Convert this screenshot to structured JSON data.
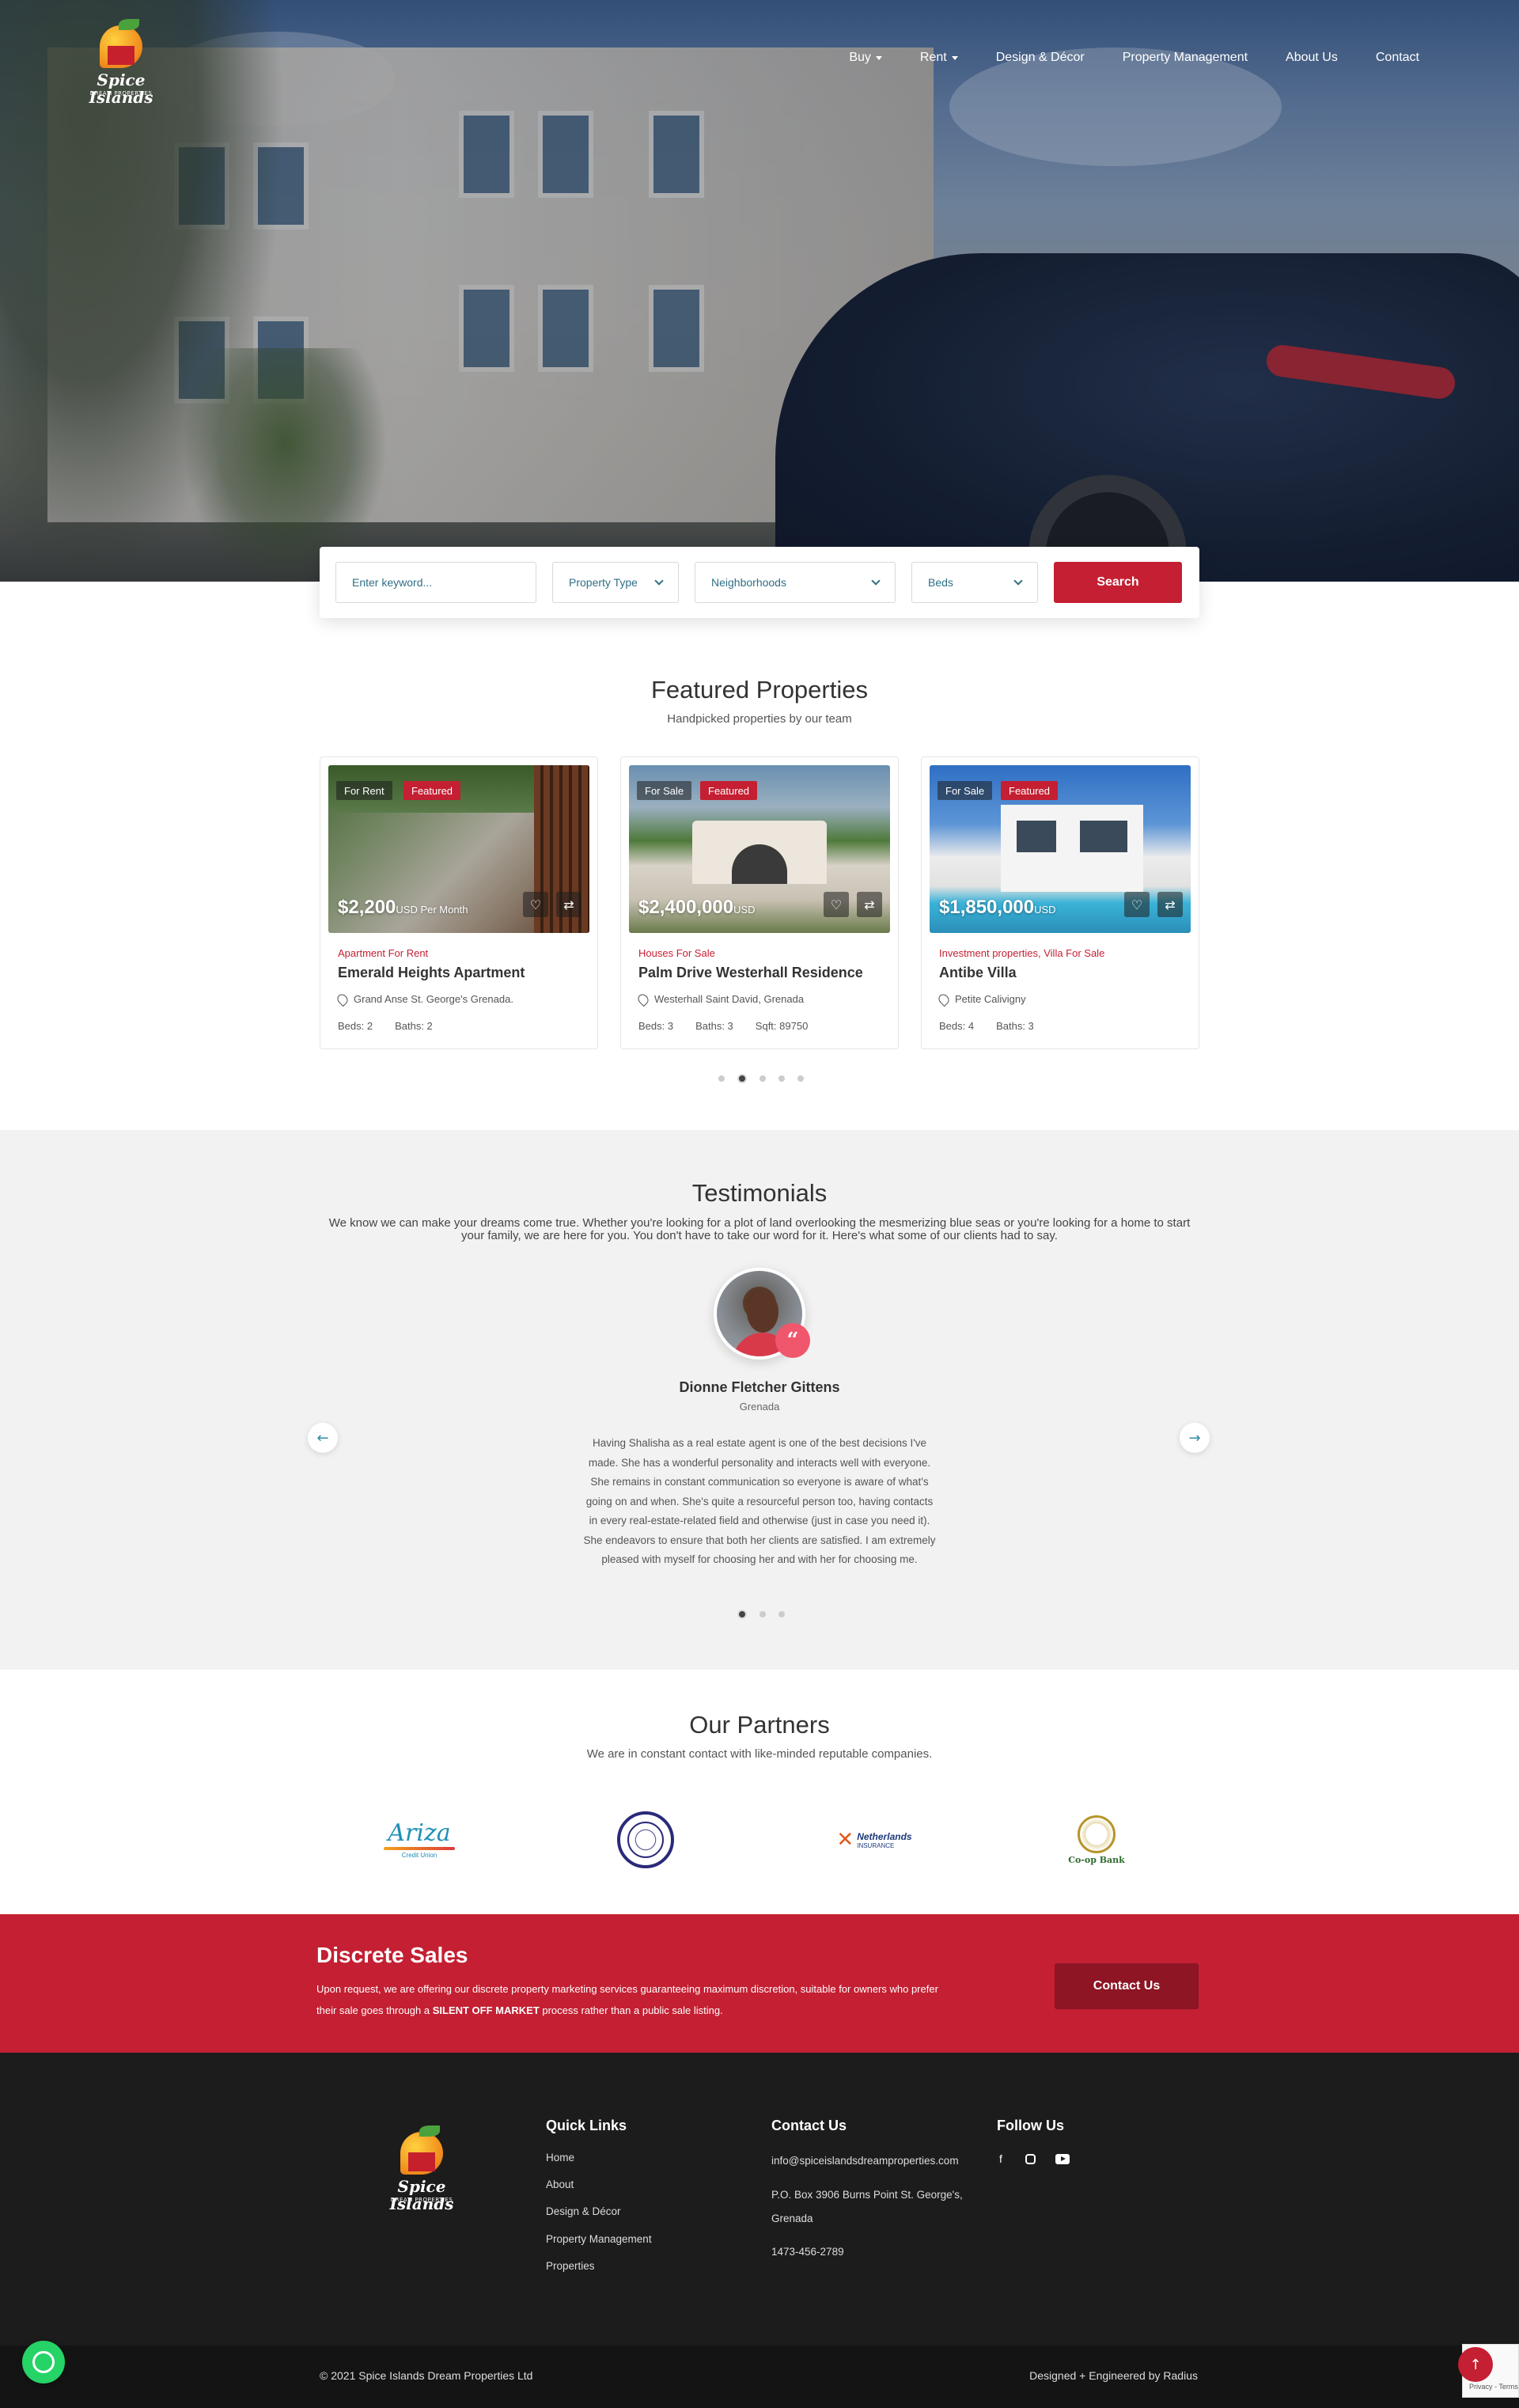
{
  "brand": {
    "logo_text": "Spice Islands",
    "logo_subtext": "DREAM PROPERTIES"
  },
  "nav": {
    "items": [
      {
        "label": "Buy",
        "has_dropdown": true
      },
      {
        "label": "Rent",
        "has_dropdown": true
      },
      {
        "label": "Design & Décor",
        "has_dropdown": false
      },
      {
        "label": "Property Management",
        "has_dropdown": false
      },
      {
        "label": "About Us",
        "has_dropdown": false
      },
      {
        "label": "Contact",
        "has_dropdown": false
      }
    ]
  },
  "search": {
    "keyword_placeholder": "Enter keyword...",
    "property_type": "Property Type",
    "neighborhoods": "Neighborhoods",
    "beds": "Beds",
    "button_label": "Search"
  },
  "featured": {
    "title": "Featured Properties",
    "subtitle": "Handpicked properties by our team",
    "cards": [
      {
        "status": "For Rent",
        "badge": "Featured",
        "price": "$2,200",
        "price_suffix": "USD Per Month",
        "category": "Apartment For Rent",
        "title": "Emerald Heights Apartment",
        "address": "Grand Anse St. George's Grenada.",
        "specs": [
          "Beds: 2",
          "Baths: 2"
        ]
      },
      {
        "status": "For Sale",
        "badge": "Featured",
        "price": "$2,400,000",
        "price_suffix": "USD",
        "category": "Houses For Sale",
        "title": "Palm Drive Westerhall Residence",
        "address": "Westerhall Saint David, Grenada",
        "specs": [
          "Beds: 3",
          "Baths: 3",
          "Sqft: 89750"
        ]
      },
      {
        "status": "For Sale",
        "badge": "Featured",
        "price": "$1,850,000",
        "price_suffix": "USD",
        "category": "Investment properties, Villa For Sale",
        "title": "Antibe Villa",
        "address": "Petite Calivigny",
        "specs": [
          "Beds: 4",
          "Baths: 3"
        ]
      }
    ],
    "carousel_pages": 5,
    "carousel_active": 1
  },
  "testimonials": {
    "title": "Testimonials",
    "intro": "We know we can make your dreams come true. Whether you're looking for a plot of land overlooking the mesmerizing blue seas or you're looking for a home to start your family, we are here for you. You don't have to take our word for it. Here's what some of our clients had to say.",
    "name": "Dionne Fletcher Gittens",
    "location": "Grenada",
    "quote": "Having Shalisha as a real estate agent is one of the best decisions I've made. She has a wonderful personality and interacts well with everyone. She remains in constant communication so everyone is aware of what's going on and when. She's quite a resourceful person too, having contacts in every real-estate-related field and otherwise (just in case you need it). She endeavors to ensure that both her clients are satisfied. I am extremely pleased with myself for choosing her and with her for choosing me.",
    "carousel_pages": 3,
    "carousel_active": 0
  },
  "partners": {
    "title": "Our Partners",
    "subtitle": "We are in constant contact with like-minded reputable companies.",
    "logos": [
      {
        "name": "Ariza",
        "sub": "Credit Union"
      },
      {
        "name": "",
        "sub": ""
      },
      {
        "name": "Netherlands",
        "sub": "INSURANCE"
      },
      {
        "name": "Co-op Bank",
        "sub": ""
      }
    ]
  },
  "discrete": {
    "title": "Discrete Sales",
    "text_before": "Upon request, we are offering our discrete property marketing services guaranteeing maximum discretion, suitable for owners who prefer their sale goes through a ",
    "text_bold": "SILENT OFF MARKET",
    "text_after": " process rather than a public sale listing.",
    "button_label": "Contact Us"
  },
  "footer": {
    "quick_links_title": "Quick Links",
    "quick_links": [
      "Home",
      "About",
      "Design & Décor",
      "Property Management",
      "Properties"
    ],
    "contact_title": "Contact Us",
    "email": "info@spiceislandsdreamproperties.com",
    "address": "P.O. Box 3906 Burns Point St. George's, Grenada",
    "phone": "1473-456-2789",
    "follow_title": "Follow Us",
    "social": [
      "facebook-icon",
      "instagram-icon",
      "youtube-icon"
    ],
    "copyright": "© 2021 Spice Islands Dream Properties Ltd",
    "credit": "Designed + Engineered by Radius"
  },
  "recaptcha_text": "Privacy - Terms",
  "colors": {
    "accent": "#c41f32",
    "footer_bg": "#1c1c1c",
    "testimonial_bg": "#f2f2f2"
  }
}
